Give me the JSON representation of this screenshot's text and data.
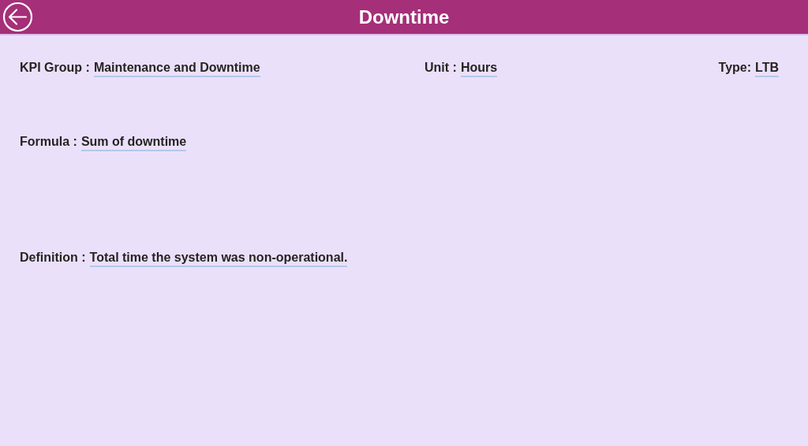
{
  "header": {
    "title": "Downtime"
  },
  "top_fields": [
    {
      "label": "KPI Group :",
      "value": "Maintenance and Downtime"
    },
    {
      "label": "Unit :",
      "value": "Hours"
    },
    {
      "label": "Type:",
      "value": "LTB"
    }
  ],
  "formula": {
    "label": "Formula :",
    "value": "Sum of downtime"
  },
  "definition": {
    "label": "Definition :",
    "value": "Total time the system was non-operational."
  }
}
